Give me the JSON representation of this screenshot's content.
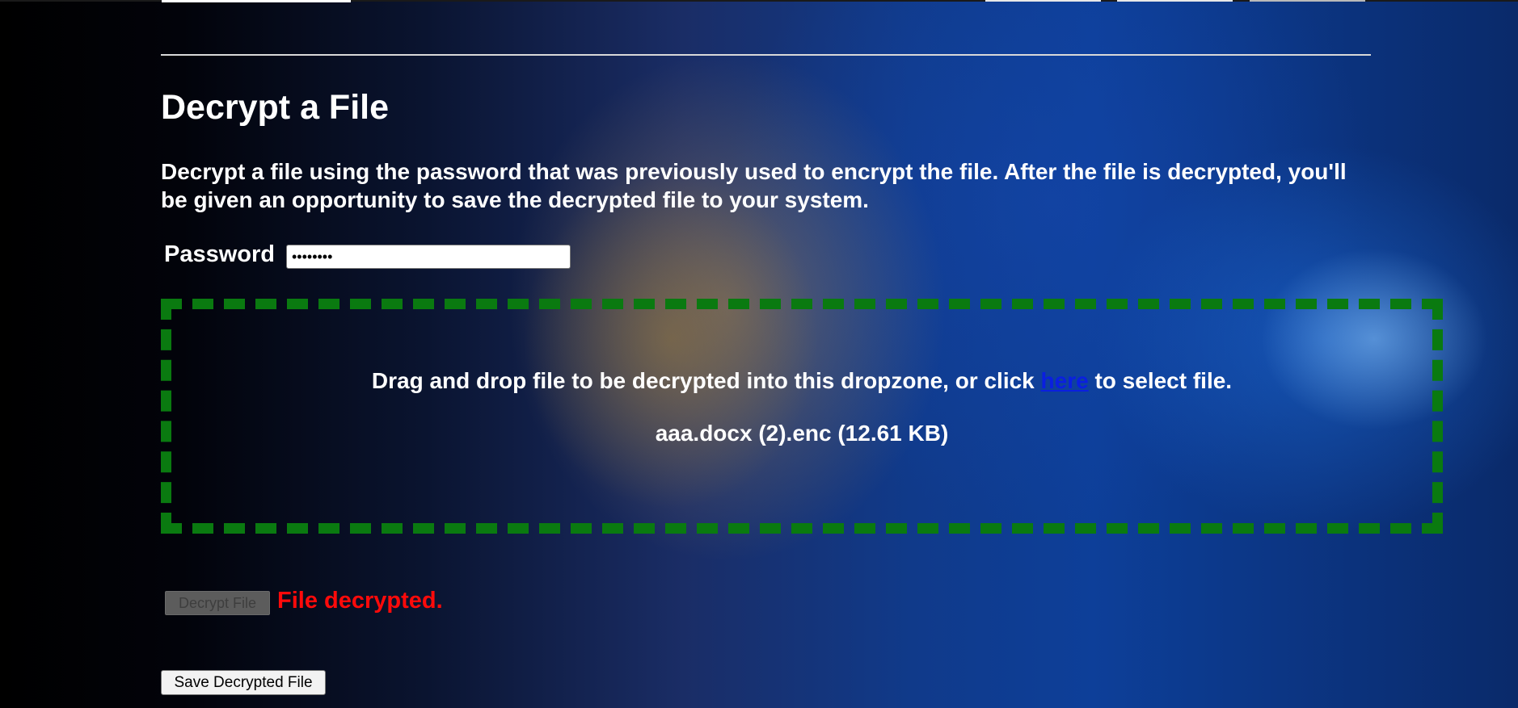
{
  "page": {
    "title": "Decrypt a File",
    "description": "Decrypt a file using the password that was previously used to encrypt the file. After the file is decrypted, you'll be given an opportunity to save the decrypted file to your system."
  },
  "password": {
    "label": "Password",
    "value": "••••••••"
  },
  "dropzone": {
    "instruction_before": "Drag and drop file to be decrypted into this dropzone, or click ",
    "link_text": "here",
    "instruction_after": " to select file.",
    "file_info": "aaa.docx (2).enc (12.61 KB)",
    "border_color": "#0a7a10"
  },
  "actions": {
    "decrypt_label": "Decrypt File",
    "decrypt_enabled": false,
    "status": "File decrypted.",
    "status_color": "#ff0a0a",
    "save_label": "Save Decrypted File"
  }
}
